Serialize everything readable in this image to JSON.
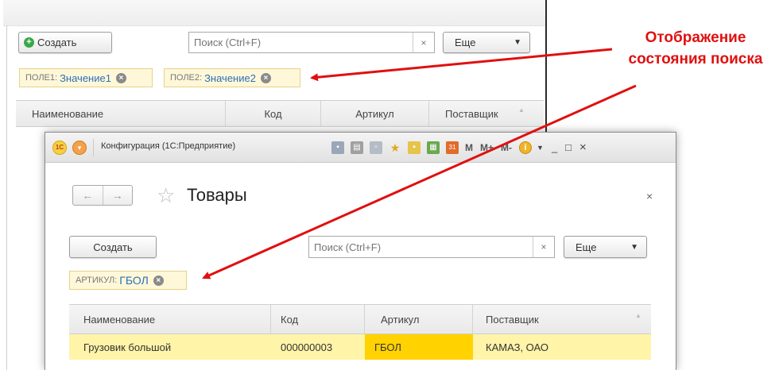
{
  "back_window": {
    "create_label": "Создать",
    "search_placeholder": "Поиск (Ctrl+F)",
    "search_clear": "×",
    "more_label": "Еще",
    "filters": [
      {
        "field": "поле1:",
        "value": "Значение1"
      },
      {
        "field": "поле2:",
        "value": "Значение2"
      }
    ],
    "columns": [
      "Наименование",
      "Код",
      "Артикул",
      "Поставщик"
    ]
  },
  "front_window": {
    "title": "Конфигурация (1С:Предприятие)",
    "logo_text": "1С",
    "toolbar_texts": [
      "M",
      "M+",
      "M-"
    ],
    "window_controls": [
      "_",
      "□",
      "×"
    ],
    "back_arrow": "←",
    "forward_arrow": "→",
    "star": "☆",
    "page_title": "Товары",
    "close_form": "×",
    "create_label": "Создать",
    "search_placeholder": "Поиск (Ctrl+F)",
    "search_clear": "×",
    "more_label": "Еще",
    "filter": {
      "field": "артикул:",
      "value": "ГБОЛ"
    },
    "columns": [
      "Наименование",
      "Код",
      "Артикул",
      "Поставщик"
    ],
    "rows": [
      {
        "name": "Грузовик большой",
        "code": "000000003",
        "article": "ГБОЛ",
        "supplier": "КАМАЗ, ОАО"
      }
    ]
  },
  "annotation": {
    "line1": "Отображение",
    "line2": "состояния поиска",
    "color": "#e01010"
  }
}
